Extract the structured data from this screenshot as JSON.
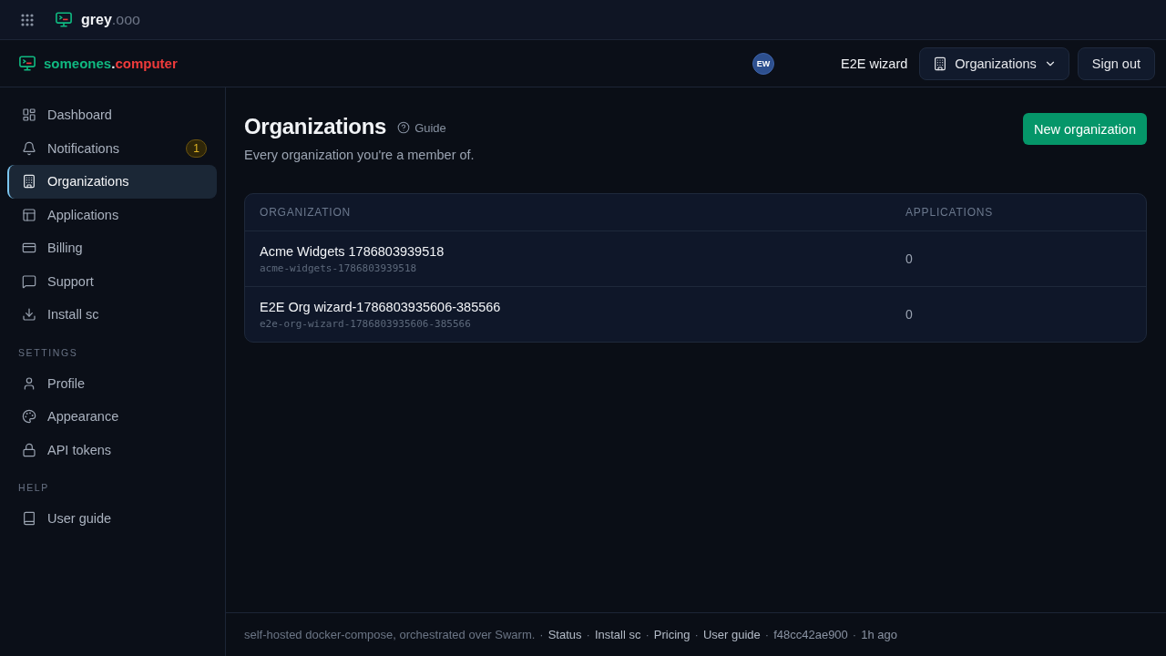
{
  "app_bar": {
    "brand": "grey",
    "brand_suffix": ".ooo"
  },
  "header": {
    "brand": {
      "name": "someones",
      "dot": ".",
      "suffix": "computer"
    },
    "user": {
      "initials": "EW",
      "name": "E2E wizard"
    },
    "org_menu": {
      "label": "Organizations"
    },
    "sign_out": {
      "label": "Sign out"
    }
  },
  "sidebar": {
    "sections": [
      {
        "items": [
          {
            "label": "Dashboard",
            "selected": false
          },
          {
            "label": "Notifications",
            "selected": false,
            "badge": "1"
          },
          {
            "label": "Organizations",
            "selected": true
          },
          {
            "label": "Applications",
            "selected": false
          },
          {
            "label": "Billing",
            "selected": false
          },
          {
            "label": "Support",
            "selected": false
          },
          {
            "label": "Install sc",
            "selected": false
          }
        ]
      },
      {
        "heading": "SETTINGS",
        "items": [
          {
            "label": "Profile",
            "selected": false
          },
          {
            "label": "Appearance",
            "selected": false
          },
          {
            "label": "API tokens",
            "selected": false
          }
        ]
      },
      {
        "heading": "HELP",
        "items": [
          {
            "label": "User guide",
            "selected": false
          }
        ]
      }
    ]
  },
  "page": {
    "title": "Organizations",
    "guide_link": "Guide",
    "subtitle": "Every organization you're a member of.",
    "primary_action": "New organization"
  },
  "table": {
    "columns": [
      "ORGANIZATION",
      "APPLICATIONS"
    ],
    "rows": [
      {
        "name": "Acme Widgets 1786803939518",
        "slug": "acme-widgets-1786803939518",
        "applications": "0"
      },
      {
        "name": "E2E Org wizard-1786803935606-385566",
        "slug": "e2e-org-wizard-1786803935606-385566",
        "applications": "0"
      }
    ]
  },
  "footer": {
    "tagline": "self-hosted docker-compose, orchestrated over Swarm.",
    "separator": "·",
    "links": [
      "Status",
      "Install sc",
      "Pricing",
      "User guide"
    ],
    "commit": "f48cc42ae900",
    "age": "1h ago"
  }
}
